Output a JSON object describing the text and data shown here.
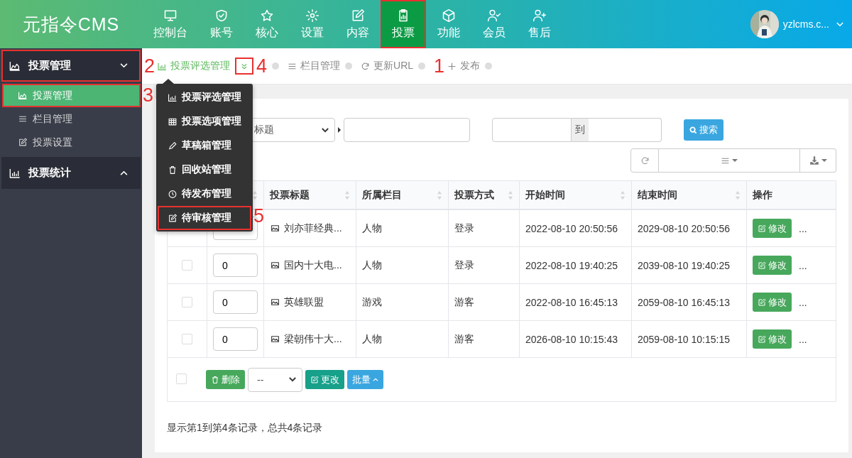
{
  "header": {
    "logo": "元指令CMS",
    "nav": [
      {
        "label": "控制台",
        "selected": false,
        "highlighted": false
      },
      {
        "label": "账号",
        "selected": false,
        "highlighted": false
      },
      {
        "label": "核心",
        "selected": false,
        "highlighted": false
      },
      {
        "label": "设置",
        "selected": false,
        "highlighted": false
      },
      {
        "label": "内容",
        "selected": false,
        "highlighted": false
      },
      {
        "label": "投票",
        "selected": true,
        "highlighted": true
      },
      {
        "label": "功能",
        "selected": false,
        "highlighted": false
      },
      {
        "label": "会员",
        "selected": false,
        "highlighted": false
      },
      {
        "label": "售后",
        "selected": false,
        "highlighted": false
      }
    ],
    "user": {
      "name": "yzlcms.c..."
    }
  },
  "sidebar": {
    "groups": [
      {
        "label": "投票管理",
        "expanded": true,
        "highlighted": true,
        "items": [
          {
            "label": "投票管理",
            "selected": true,
            "highlighted": true
          },
          {
            "label": "栏目管理",
            "selected": false,
            "highlighted": false
          },
          {
            "label": "投票设置",
            "selected": false,
            "highlighted": false
          }
        ]
      },
      {
        "label": "投票统计",
        "expanded": false,
        "highlighted": false
      }
    ]
  },
  "breadcrumb": {
    "items": [
      {
        "label": "投票评选管理",
        "selected": true
      },
      {
        "label": "栏目管理",
        "selected": false
      },
      {
        "label": "更新URL",
        "selected": false
      },
      {
        "label": "发布",
        "selected": false
      }
    ],
    "menu_toggle": {
      "highlighted": true
    }
  },
  "dropdown_menu": [
    {
      "label": "投票评选管理",
      "highlighted": false
    },
    {
      "label": "投票选项管理",
      "highlighted": false
    },
    {
      "label": "草稿箱管理",
      "highlighted": false
    },
    {
      "label": "回收站管理",
      "highlighted": false
    },
    {
      "label": "待发布管理",
      "highlighted": false
    },
    {
      "label": "待审核管理",
      "highlighted": true
    }
  ],
  "search": {
    "field_select": "标题",
    "range_separator": "到",
    "button": "搜索"
  },
  "table": {
    "columns": [
      {
        "label": "投票标题",
        "sortable": true
      },
      {
        "label": "所属栏目",
        "sortable": true
      },
      {
        "label": "投票方式",
        "sortable": true
      },
      {
        "label": "开始时间",
        "sortable": true
      },
      {
        "label": "结束时间",
        "sortable": true
      },
      {
        "label": "操作",
        "sortable": false
      }
    ],
    "rows": [
      {
        "title": "刘亦菲经典...",
        "category": "人物",
        "method": "登录",
        "start": "2022-08-10 20:50:56",
        "end": "2029-08-10 20:50:56",
        "action": "修改",
        "more": "..."
      },
      {
        "checked": false,
        "order": "0",
        "title": "国内十大电...",
        "category": "人物",
        "method": "登录",
        "start": "2022-08-10 19:40:25",
        "end": "2039-08-10 19:40:25",
        "action": "修改",
        "more": "..."
      },
      {
        "checked": false,
        "order": "0",
        "title": "英雄联盟",
        "category": "游戏",
        "method": "游客",
        "start": "2022-08-10 16:45:13",
        "end": "2059-08-10 16:45:13",
        "action": "修改",
        "more": "..."
      },
      {
        "checked": false,
        "order": "0",
        "title": "梁朝伟十大...",
        "category": "人物",
        "method": "游客",
        "start": "2026-08-10 10:15:43",
        "end": "2059-08-10 10:15:15",
        "action": "修改",
        "more": "..."
      }
    ],
    "footer": {
      "checked": false,
      "delete": "删除",
      "batch_select": "--",
      "change": "更改",
      "batch": "批量"
    }
  },
  "summary": "显示第1到第4条记录，总共4条记录",
  "annotations": [
    {
      "label": "2"
    },
    {
      "label": "4"
    },
    {
      "label": "1"
    },
    {
      "label": "3"
    },
    {
      "label": "5"
    }
  ]
}
